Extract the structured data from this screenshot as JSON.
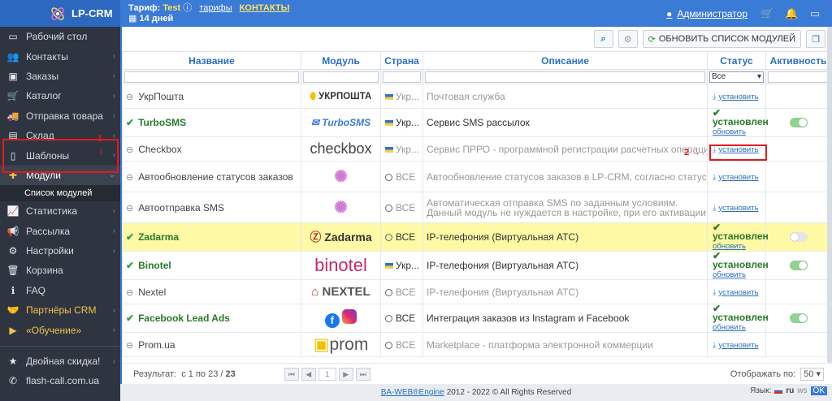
{
  "header": {
    "logo": "LP-CRM",
    "tariff_label": "Тариф:",
    "tariff_name": "Test",
    "tariffs_link": "тарифы",
    "contacts_link": "КОНТАКТЫ",
    "days": "14 дней",
    "user": "Администратор"
  },
  "sidebar": {
    "items": [
      {
        "label": "Рабочий стол",
        "icon": "monitor-icon"
      },
      {
        "label": "Контакты",
        "icon": "users-icon"
      },
      {
        "label": "Заказы",
        "icon": "money-icon"
      },
      {
        "label": "Каталог",
        "icon": "cart-icon"
      },
      {
        "label": "Отправка товара",
        "icon": "truck-icon"
      },
      {
        "label": "Склад",
        "icon": "warehouse-icon"
      },
      {
        "label": "Шаблоны",
        "icon": "file-icon"
      },
      {
        "label": "Модули",
        "icon": "puzzle-icon"
      },
      {
        "label": "Статистика",
        "icon": "chart-icon"
      },
      {
        "label": "Рассылка",
        "icon": "megaphone-icon"
      },
      {
        "label": "Настройки",
        "icon": "gear-icon"
      },
      {
        "label": "Корзина",
        "icon": "trash-icon"
      },
      {
        "label": "FAQ",
        "icon": "info-icon"
      },
      {
        "label": "Партнёры CRM",
        "icon": "handshake-icon"
      },
      {
        "label": "«Обучение»",
        "icon": "video-icon"
      },
      {
        "label": "Двойная скидка!",
        "icon": "star-icon"
      },
      {
        "label": "flash-call.com.ua",
        "icon": "phone-icon"
      }
    ],
    "submenu": "Список модулей",
    "marker1": "1"
  },
  "toolbar": {
    "refresh_label": "ОБНОВИТЬ СПИСОК МОДУЛЕЙ"
  },
  "table": {
    "headers": [
      "Название",
      "Модуль",
      "Страна",
      "Описание",
      "Статус",
      "Активность"
    ],
    "status_filter": "Все",
    "rows": [
      {
        "name": "УкрПошта",
        "logo": "УКРПОШТА",
        "country": "Укр...",
        "desc": "Почтовая служба",
        "installed": false
      },
      {
        "name": "TurboSMS",
        "logo": "TurboSMS",
        "country": "Укр...",
        "desc": "Сервис SMS рассылок",
        "installed": true
      },
      {
        "name": "Checkbox",
        "logo": "checkbox",
        "country": "Укр...",
        "desc": "Сервис ПРРО - программной регистрации расчетных операций",
        "installed": false
      },
      {
        "name": "Автообновление статусов заказов",
        "logo": "",
        "country": "ВСЕ",
        "desc": "Автообновление статусов заказов в LP-CRM, согласно статусам ТТН почто...",
        "installed": false
      },
      {
        "name": "Автоотправка SMS",
        "logo": "",
        "country": "ВСЕ",
        "desc": "Автоматическая отправка SMS по заданным условиям.",
        "desc2": "Данный модуль не нуждается в настройке, при его активации добавляют...",
        "installed": false
      },
      {
        "name": "Zadarma",
        "logo": "Zadarma",
        "country": "ВСЕ",
        "desc": "IP-телефония (Виртуальная АТС)",
        "installed": true
      },
      {
        "name": "Binotel",
        "logo": "binotel",
        "country": "Укр...",
        "desc": "IP-телефония (Виртуальная АТС)",
        "installed": true
      },
      {
        "name": "Nextel",
        "logo": "NEXTEL",
        "country": "ВСЕ",
        "desc": "IP-телефония (Виртуальная АТС)",
        "installed": false
      },
      {
        "name": "Facebook Lead Ads",
        "logo": "",
        "country": "ВСЕ",
        "desc": "Интеграция заказов из Instagram и Facebook",
        "installed": true
      },
      {
        "name": "Prom.ua",
        "logo": "prom",
        "country": "ВСЕ",
        "desc": "Marketplace - платформа электронной коммерции",
        "installed": false
      }
    ],
    "install_label": "установить",
    "installed_label": "установлен",
    "update_label": "обновить",
    "marker2": "2"
  },
  "pager": {
    "result_label": "Результат:",
    "range": "с 1 по 23 /",
    "total": "23",
    "page": "1",
    "show_label": "Отображать по:",
    "per_page": "50"
  },
  "footer": {
    "brand": "BA-WEB®Engine",
    "copy": "2012 - 2022 © All Rights Reserved",
    "lang_label": "Язык:",
    "lang": "ru",
    "ws": "ws",
    "ok": "OK"
  },
  "colors": {
    "accent": "#3a7bd5",
    "sidebar": "#2f3540",
    "highlight": "#fdf9a5",
    "marker": "#e21b1b"
  }
}
